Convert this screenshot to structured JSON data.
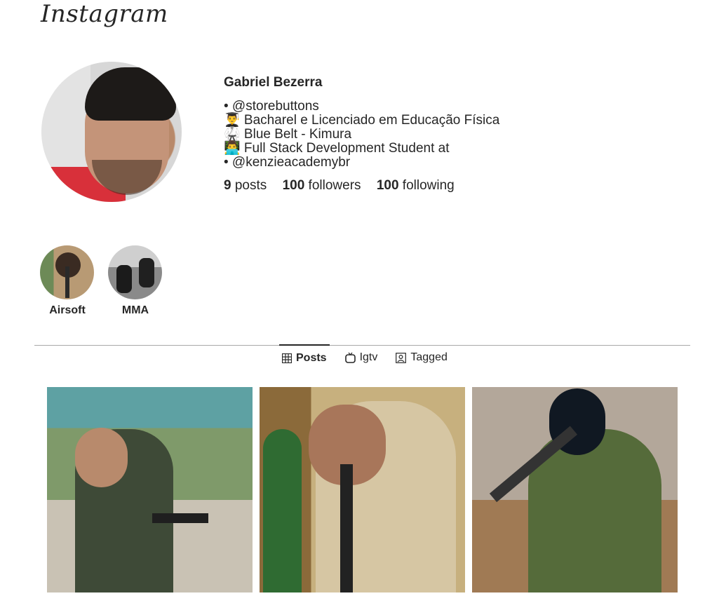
{
  "header": {
    "logo_text": "Instagram"
  },
  "profile": {
    "name": "Gabriel Bezerra",
    "bio": [
      "• @storebuttons",
      "👨‍🎓 Bacharel e Licenciado em Educação Física",
      "🥋 Blue Belt - Kimura",
      "👨‍💻 Full Stack Development Student at",
      "• @kenzieacademybr"
    ],
    "stats": {
      "posts_count": "9",
      "posts_label": "posts",
      "followers_count": "100",
      "followers_label": "followers",
      "following_count": "100",
      "following_label": "following"
    }
  },
  "highlights": [
    {
      "label": "Airsoft"
    },
    {
      "label": "MMA"
    }
  ],
  "tabs": [
    {
      "label": "Posts",
      "icon": "grid-icon",
      "active": true
    },
    {
      "label": "Igtv",
      "icon": "tv-icon",
      "active": false
    },
    {
      "label": "Tagged",
      "icon": "tag-icon",
      "active": false
    }
  ]
}
